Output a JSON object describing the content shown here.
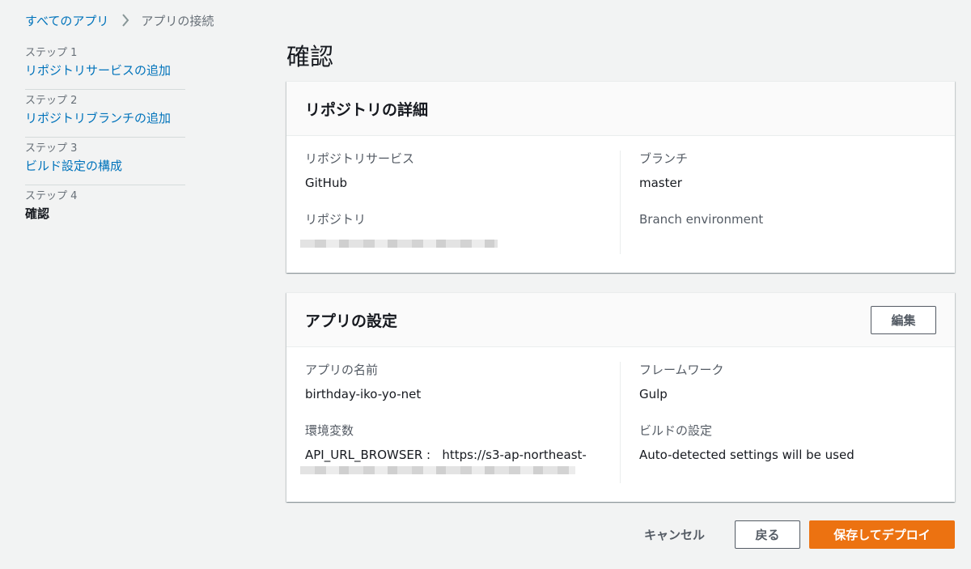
{
  "breadcrumb": {
    "root": "すべてのアプリ",
    "current": "アプリの接続"
  },
  "steps": [
    {
      "num": "ステップ 1",
      "title": "リポジトリサービスの追加"
    },
    {
      "num": "ステップ 2",
      "title": "リポジトリブランチの追加"
    },
    {
      "num": "ステップ 3",
      "title": "ビルド設定の構成"
    },
    {
      "num": "ステップ 4",
      "title": "確認"
    }
  ],
  "page_title": "確認",
  "repo_panel": {
    "title": "リポジトリの詳細",
    "service_label": "リポジトリサービス",
    "service_value": "GitHub",
    "repo_label": "リポジトリ",
    "branch_label": "ブランチ",
    "branch_value": "master",
    "branch_env_label": "Branch environment"
  },
  "app_panel": {
    "title": "アプリの設定",
    "edit_label": "編集",
    "app_name_label": "アプリの名前",
    "app_name_value": "birthday-iko-yo-net",
    "env_label": "環境変数",
    "env_value": "API_URL_BROWSER :   https://s3-ap-northeast-",
    "framework_label": "フレームワーク",
    "framework_value": "Gulp",
    "build_label": "ビルドの設定",
    "build_value": "Auto-detected settings will be used"
  },
  "actions": {
    "cancel": "キャンセル",
    "back": "戻る",
    "save_deploy": "保存してデプロイ"
  },
  "colors": {
    "link": "#0073bb",
    "primary": "#ec7211",
    "background": "#f2f3f3"
  }
}
